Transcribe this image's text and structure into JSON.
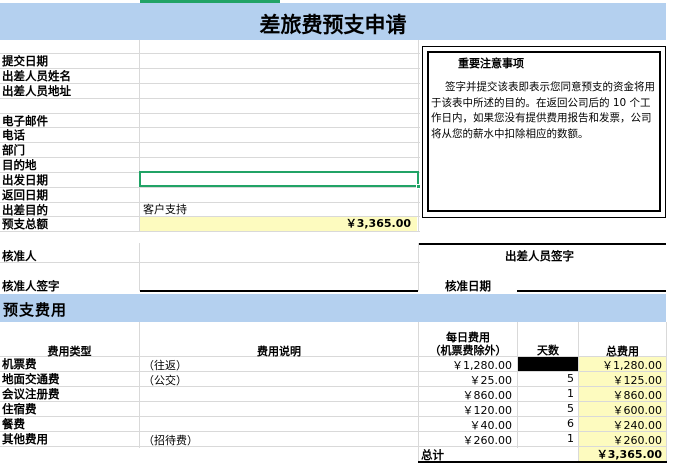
{
  "title": "差旅费预支申请",
  "form": {
    "submit_date_label": "提交日期",
    "traveler_name_label": "出差人员姓名",
    "traveler_address_label": "出差人员地址",
    "email_label": "电子邮件",
    "phone_label": "电话",
    "department_label": "部门",
    "destination_label": "目的地",
    "depart_date_label": "出发日期",
    "return_date_label": "返回日期",
    "purpose_label": "出差目的",
    "purpose_value": "客户支持",
    "total_label": "预支总额",
    "total_value": "￥3,365.00"
  },
  "notice": {
    "title": "重要注意事项",
    "body": "签字并提交该表即表示您同意预支的资金将用于该表中所述的目的。在返回公司后的 10 个工作日内，如果您没有提供费用报告和发票，公司将从您的薪水中扣除相应的数额。"
  },
  "approval": {
    "approver_label": "核准人",
    "approver_sign_label": "核准人签字",
    "traveler_sign_label": "出差人员签字",
    "approval_date_label": "核准日期"
  },
  "section_title": "预支费用",
  "table": {
    "headers": {
      "type": "费用类型",
      "desc": "费用说明",
      "daily_line1": "每日费用",
      "daily_line2": "（机票费除外）",
      "days": "天数",
      "total": "总费用"
    },
    "rows": [
      {
        "type": "机票费",
        "desc": "（往返）",
        "daily": "￥1,280.00",
        "days": "",
        "total": "￥1,280.00"
      },
      {
        "type": "地面交通费",
        "desc": "（公交）",
        "daily": "￥25.00",
        "days": "5",
        "total": "￥125.00"
      },
      {
        "type": "会议注册费",
        "desc": "",
        "daily": "￥860.00",
        "days": "1",
        "total": "￥860.00"
      },
      {
        "type": "住宿费",
        "desc": "",
        "daily": "￥120.00",
        "days": "5",
        "total": "￥600.00"
      },
      {
        "type": "餐费",
        "desc": "",
        "daily": "￥40.00",
        "days": "6",
        "total": "￥240.00"
      },
      {
        "type": "其他费用",
        "desc": "（招待费）",
        "daily": "￥260.00",
        "days": "1",
        "total": "￥260.00"
      }
    ],
    "sum_label": "总计",
    "sum_value": "￥3,365.00"
  }
}
